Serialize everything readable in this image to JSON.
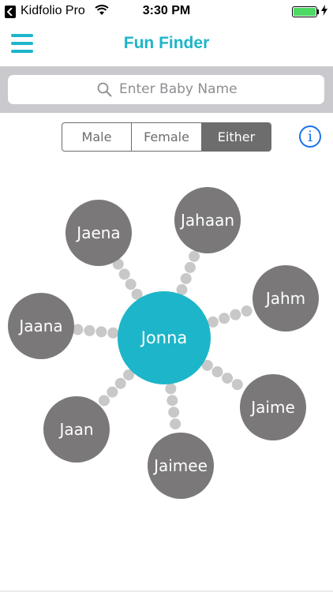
{
  "status_bar": {
    "carrier": "Kidfolio Pro",
    "time": "3:30 PM"
  },
  "nav": {
    "title": "Fun Finder"
  },
  "search": {
    "placeholder": "Enter Baby Name"
  },
  "gender_filter": {
    "options": [
      "Male",
      "Female",
      "Either"
    ],
    "selected": "Either"
  },
  "web": {
    "center": "Jonna",
    "names": [
      "Jaena",
      "Jahaan",
      "Jahm",
      "Jaime",
      "Jaimee",
      "Jaan",
      "Jaana"
    ]
  },
  "colors": {
    "accent": "#1db5c9",
    "bubble": "#7a7878",
    "dots": "#c8c8c8",
    "segment": "#6d6d6d",
    "info": "#1a73e8"
  }
}
